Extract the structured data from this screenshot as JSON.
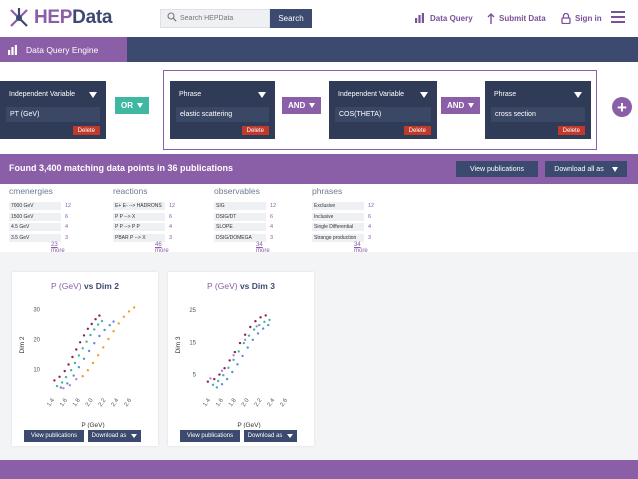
{
  "brand": {
    "hep": "HEP",
    "data": "Data"
  },
  "search": {
    "placeholder": "Search HEPData",
    "button": "Search"
  },
  "nav": {
    "data_query": "Data Query",
    "submit_data": "Submit Data",
    "sign_in": "Sign in"
  },
  "engine": {
    "title": "Data Query Engine"
  },
  "query": {
    "cards": [
      {
        "head": "Independent Variable",
        "value": "PT (GeV)",
        "delete": "Delete"
      },
      {
        "head": "Phrase",
        "value": "elastic scattering",
        "delete": "Delete"
      },
      {
        "head": "Independent Variable",
        "value": "COS(THETA)",
        "delete": "Delete"
      },
      {
        "head": "Phrase",
        "value": "cross section",
        "delete": "Delete"
      }
    ],
    "ops": [
      "OR",
      "AND",
      "AND"
    ],
    "add": "+"
  },
  "results": {
    "found": "Found 3,400 matching data points in 36 publications",
    "view_publications": "View publications",
    "download_all": "Download all as"
  },
  "facets": [
    {
      "title": "cmenergies",
      "items": [
        {
          "label": "7000 GeV",
          "count": "12"
        },
        {
          "label": "1500 GeV",
          "count": "6"
        },
        {
          "label": "4.5 GeV",
          "count": "4"
        },
        {
          "label": "3.5 GeV",
          "count": "3"
        }
      ],
      "more": "23 more"
    },
    {
      "title": "reactions",
      "items": [
        {
          "label": "E+ E- --> HADRONS",
          "count": "12"
        },
        {
          "label": "P P --> X",
          "count": "6"
        },
        {
          "label": "P P --> P P",
          "count": "4"
        },
        {
          "label": "PBAR P --> X",
          "count": "3"
        }
      ],
      "more": "46 more"
    },
    {
      "title": "observables",
      "items": [
        {
          "label": "SIG",
          "count": "12"
        },
        {
          "label": "DSIG/DT",
          "count": "6"
        },
        {
          "label": "SLOPE",
          "count": "4"
        },
        {
          "label": "DSIG/DOMEGA",
          "count": "3"
        }
      ],
      "more": "34 more"
    },
    {
      "title": "phrases",
      "items": [
        {
          "label": "Exclusive",
          "count": "12"
        },
        {
          "label": "Inclusive",
          "count": "6"
        },
        {
          "label": "Single Differential",
          "count": "4"
        },
        {
          "label": "Strange production",
          "count": "3"
        }
      ],
      "more": "34 more"
    }
  ],
  "plots": [
    {
      "title_a": "P (GeV)",
      "title_vs": " vs ",
      "title_b": "Dim 2",
      "view": "View publications",
      "download": "Download as"
    },
    {
      "title_a": "P (GeV)",
      "title_vs": " vs ",
      "title_b": "Dim 3",
      "view": "View publications",
      "download": "Download as"
    }
  ],
  "chart_data": [
    {
      "type": "scatter",
      "title": "P (GeV) vs Dim 2",
      "xlabel": "P (GeV)",
      "ylabel": "Dim 2",
      "xlim": [
        1.3,
        2.7
      ],
      "ylim": [
        3,
        33
      ],
      "xticks": [
        "1.4",
        "1.6",
        "1.8",
        "2.0",
        "2.2",
        "2.4",
        "2.6"
      ],
      "yticks": [
        "10",
        "20",
        "30"
      ],
      "series": [
        {
          "color": "#8b2252",
          "points": [
            [
              1.4,
              6.2
            ],
            [
              1.48,
              7.4
            ],
            [
              1.56,
              9.3
            ],
            [
              1.62,
              11.5
            ],
            [
              1.68,
              14.0
            ],
            [
              1.74,
              16.5
            ],
            [
              1.8,
              18.9
            ],
            [
              1.86,
              21.2
            ],
            [
              1.92,
              23.4
            ],
            [
              1.98,
              25.0
            ],
            [
              2.04,
              26.6
            ],
            [
              2.1,
              27.8
            ]
          ]
        },
        {
          "color": "#3fb8a3",
          "points": [
            [
              1.44,
              4.3
            ],
            [
              1.52,
              5.5
            ],
            [
              1.58,
              7.3
            ],
            [
              1.66,
              9.6
            ],
            [
              1.72,
              12.0
            ],
            [
              1.78,
              14.5
            ],
            [
              1.84,
              16.9
            ],
            [
              1.9,
              19.1
            ],
            [
              1.96,
              21.3
            ],
            [
              2.02,
              23.2
            ],
            [
              2.08,
              24.8
            ],
            [
              2.14,
              26.0
            ]
          ]
        },
        {
          "color": "#5b8fd9",
          "points": [
            [
              1.5,
              3.8
            ],
            [
              1.6,
              5.2
            ],
            [
              1.7,
              7.8
            ],
            [
              1.78,
              10.6
            ],
            [
              1.86,
              13.4
            ],
            [
              1.94,
              16.0
            ],
            [
              2.02,
              18.6
            ],
            [
              2.1,
              21.0
            ],
            [
              2.18,
              23.0
            ],
            [
              2.26,
              24.6
            ],
            [
              2.32,
              25.8
            ]
          ]
        },
        {
          "color": "#f0a020",
          "points": [
            [
              1.84,
              7.6
            ],
            [
              1.92,
              9.6
            ],
            [
              2.0,
              12.0
            ],
            [
              2.08,
              14.6
            ],
            [
              2.16,
              17.2
            ],
            [
              2.24,
              20.0
            ],
            [
              2.32,
              22.6
            ],
            [
              2.4,
              25.2
            ],
            [
              2.48,
              27.4
            ],
            [
              2.56,
              29.2
            ],
            [
              2.64,
              30.5
            ]
          ]
        },
        {
          "color": "#b87fd6",
          "points": [
            [
              1.54,
              3.6
            ],
            [
              1.64,
              4.6
            ],
            [
              1.74,
              6.6
            ]
          ]
        }
      ]
    },
    {
      "type": "scatter",
      "title": "P (GeV) vs Dim 3",
      "xlabel": "P (GeV)",
      "ylabel": "Dim 3",
      "xlim": [
        1.3,
        2.7
      ],
      "ylim": [
        0,
        28
      ],
      "xticks": [
        "1.4",
        "1.6",
        "1.8",
        "2.0",
        "2.2",
        "2.4",
        "2.6"
      ],
      "yticks": [
        "5",
        "15",
        "25"
      ],
      "series": [
        {
          "color": "#8b2252",
          "points": [
            [
              1.36,
              2.6
            ],
            [
              1.46,
              3.4
            ],
            [
              1.54,
              4.8
            ],
            [
              1.62,
              6.8
            ],
            [
              1.7,
              9.2
            ],
            [
              1.78,
              11.8
            ],
            [
              1.86,
              14.6
            ],
            [
              1.94,
              17.2
            ],
            [
              2.02,
              19.6
            ],
            [
              2.1,
              21.4
            ],
            [
              2.18,
              22.6
            ],
            [
              2.26,
              23.2
            ]
          ]
        },
        {
          "color": "#3fb8a3",
          "points": [
            [
              1.44,
              1.6
            ],
            [
              1.52,
              2.8
            ],
            [
              1.6,
              4.6
            ],
            [
              1.68,
              6.9
            ],
            [
              1.76,
              9.4
            ],
            [
              1.84,
              12.0
            ],
            [
              1.92,
              14.6
            ],
            [
              2.0,
              16.9
            ],
            [
              2.08,
              18.8
            ],
            [
              2.16,
              20.2
            ],
            [
              2.24,
              21.2
            ],
            [
              2.32,
              21.8
            ]
          ]
        },
        {
          "color": "#5b8fd9",
          "points": [
            [
              1.5,
              0.8
            ],
            [
              1.58,
              1.8
            ],
            [
              1.66,
              3.4
            ],
            [
              1.74,
              5.6
            ],
            [
              1.82,
              8.0
            ],
            [
              1.9,
              10.6
            ],
            [
              1.98,
              13.2
            ],
            [
              2.06,
              15.6
            ],
            [
              2.14,
              17.6
            ],
            [
              2.22,
              19.1
            ],
            [
              2.3,
              20.2
            ]
          ]
        },
        {
          "color": "#b87fd6",
          "points": [
            [
              1.4,
              3.6
            ],
            [
              1.58,
              6.0
            ],
            [
              1.76,
              10.8
            ],
            [
              1.94,
              15.6
            ],
            [
              2.12,
              19.8
            ]
          ]
        }
      ]
    }
  ]
}
